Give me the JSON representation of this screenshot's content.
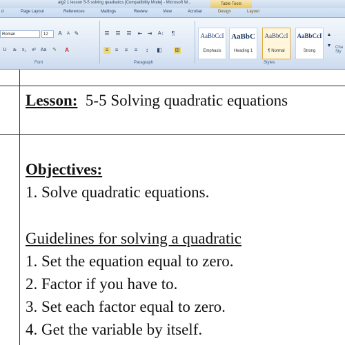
{
  "window": {
    "title": "alg2 1 lesson 5-5 solving quadratics [Compatibility Mode] - Microsoft W...",
    "contextual_tab_label": "Table Tools"
  },
  "tabs": [
    "d",
    "Page Layout",
    "References",
    "Mailings",
    "Review",
    "View",
    "Acrobat",
    "Design",
    "Layout"
  ],
  "ribbon": {
    "font": {
      "name": "Roman",
      "size": "12",
      "group_label": "Font"
    },
    "paragraph": {
      "group_label": "Paragraph"
    },
    "styles": {
      "group_label": "Styles",
      "items": [
        {
          "sample": "AaBbCcI",
          "name": "Emphasis"
        },
        {
          "sample": "AaBbC",
          "name": "Heading 1"
        },
        {
          "sample": "AaBbCcI",
          "name": "¶ Normal"
        },
        {
          "sample": "AaBbCcI",
          "name": "Strong"
        }
      ],
      "change_styles": "Cha Sty"
    }
  },
  "document": {
    "lesson_label": "Lesson:",
    "lesson_title": "5-5 Solving quadratic equations",
    "objectives_heading": "Objectives:",
    "objective_1": "1. Solve quadratic equations.",
    "guidelines_heading": "Guidelines for solving a quadratic",
    "steps": [
      "1.  Set the equation equal to zero.",
      "2.  Factor if you have to.",
      "3.  Set each factor equal to zero.",
      "4.  Get the variable by itself."
    ]
  }
}
